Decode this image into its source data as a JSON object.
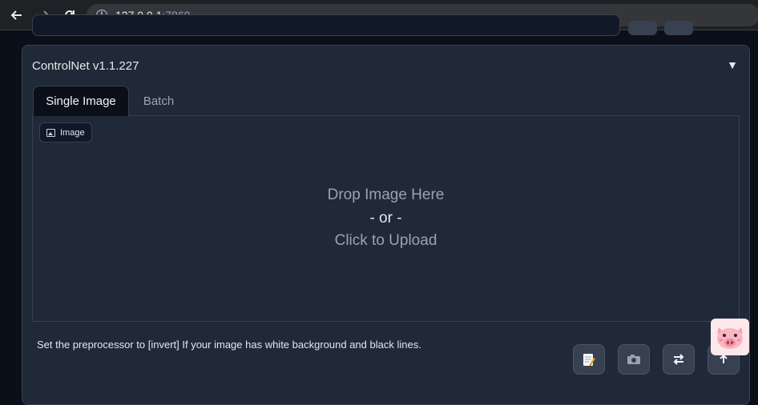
{
  "browser": {
    "url_host": "127.0.0.1",
    "url_port": ":7860"
  },
  "controlnet": {
    "title": "ControlNet v1.1.227",
    "toggle": "▼",
    "tabs": [
      {
        "label": "Single Image",
        "active": true
      },
      {
        "label": "Batch",
        "active": false
      }
    ],
    "image_label": "Image",
    "drop_line1": "Drop Image Here",
    "drop_line2": "- or -",
    "drop_line3": "Click to Upload",
    "hint": "Set the preprocessor to [invert] If your image has white background and black lines.",
    "tool_buttons": [
      {
        "icon": "edit-note-icon"
      },
      {
        "icon": "camera-icon"
      },
      {
        "icon": "swap-arrows-icon"
      },
      {
        "icon": "upload-arrow-icon"
      }
    ]
  },
  "overlay": {
    "icon": "pig-face-icon"
  }
}
